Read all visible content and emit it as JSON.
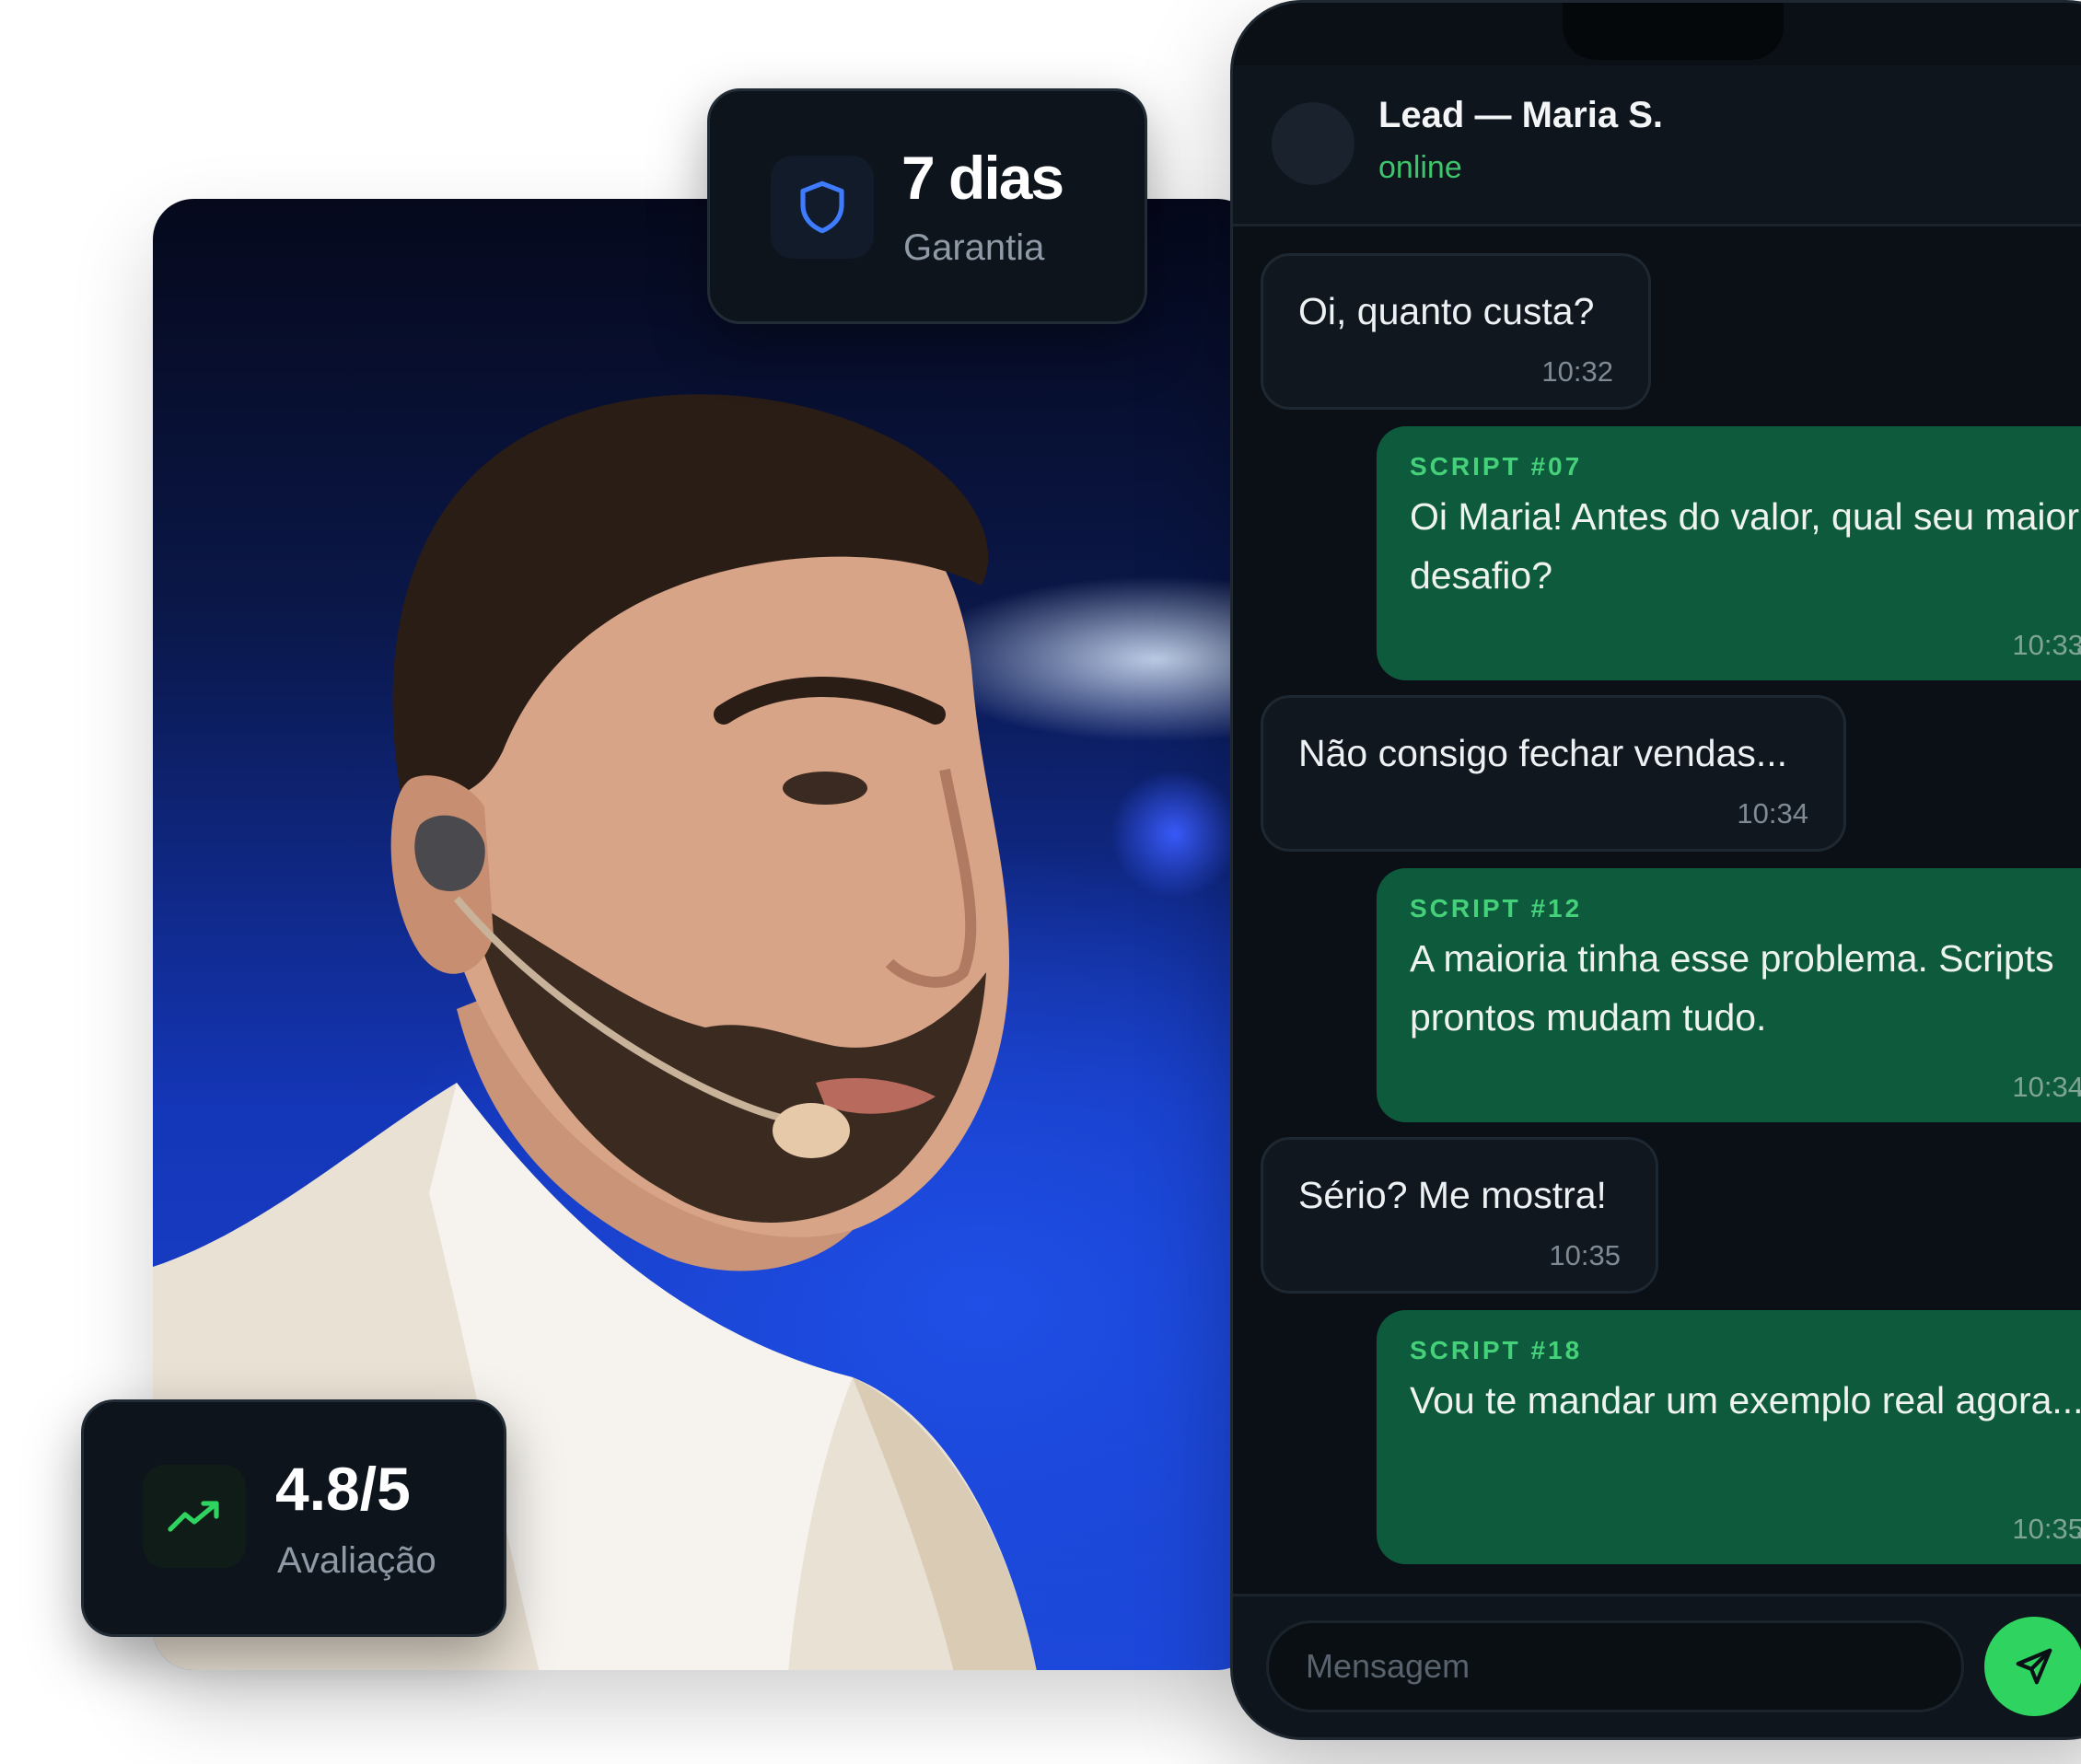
{
  "guarantee": {
    "value": "7 dias",
    "label": "Garantia",
    "icon": "shield-icon"
  },
  "rating": {
    "value": "4.8/5",
    "label": "Avaliação",
    "icon": "trending-up-icon"
  },
  "chat": {
    "contact_name": "Lead — Maria S.",
    "status": "online",
    "messages": [
      {
        "direction": "in",
        "text": "Oi, quanto custa?",
        "time": "10:32"
      },
      {
        "direction": "out",
        "tag": "SCRIPT #07",
        "text": "Oi Maria! Antes do valor, qual seu maior desafio?",
        "time": "10:33",
        "ticks": "✓✓"
      },
      {
        "direction": "in",
        "text": "Não consigo fechar vendas...",
        "time": "10:34"
      },
      {
        "direction": "out",
        "tag": "SCRIPT #12",
        "text": "A maioria tinha esse problema. Scripts prontos mudam tudo.",
        "time": "10:34",
        "ticks": "✓✓"
      },
      {
        "direction": "in",
        "text": "Sério? Me mostra!",
        "time": "10:35"
      },
      {
        "direction": "out",
        "tag": "SCRIPT #18",
        "text": "Vou te mandar um exemplo real agora...",
        "time": "10:35",
        "ticks": "✓✓"
      }
    ],
    "composer": {
      "placeholder": "Mensagem",
      "send_icon": "send-icon"
    }
  },
  "colors": {
    "accent_green": "#2fd35f",
    "outgoing_bubble": "#0d5a3c",
    "incoming_bubble": "#10171e",
    "phone_bg": "#0b1016"
  }
}
